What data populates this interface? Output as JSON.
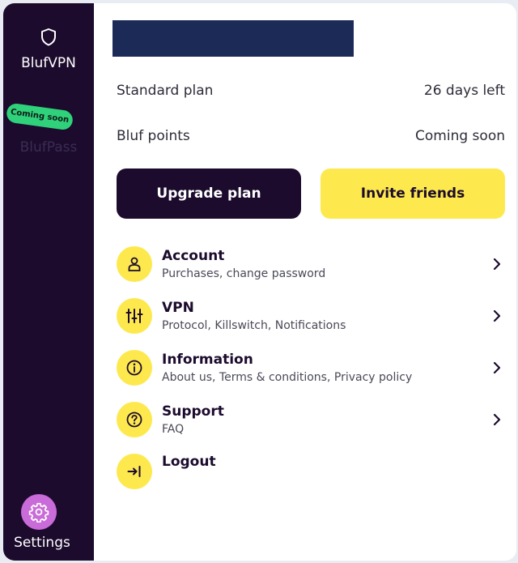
{
  "sidebar": {
    "items": [
      {
        "label": "BlufVPN",
        "icon": "shield-icon"
      },
      {
        "label": "BlufPass",
        "icon": "",
        "badge": "Coming soon"
      }
    ],
    "settings": {
      "label": "Settings",
      "icon": "gear-icon"
    }
  },
  "plan": {
    "name": "Standard plan",
    "remaining": "26 days left"
  },
  "points": {
    "label": "Bluf points",
    "value": "Coming soon"
  },
  "buttons": {
    "upgrade": "Upgrade plan",
    "invite": "Invite friends"
  },
  "menu": [
    {
      "title": "Account",
      "subtitle": "Purchases, change password",
      "icon": "user-icon"
    },
    {
      "title": "VPN",
      "subtitle": "Protocol, Killswitch, Notifications",
      "icon": "sliders-icon"
    },
    {
      "title": "Information",
      "subtitle": "About us, Terms & conditions, Privacy policy",
      "icon": "info-icon"
    },
    {
      "title": "Support",
      "subtitle": "FAQ",
      "icon": "question-icon"
    },
    {
      "title": "Logout",
      "subtitle": "",
      "icon": "logout-icon"
    }
  ],
  "colors": {
    "sidebar": "#1c0b2d",
    "accent_yellow": "#fde94e",
    "badge_green": "#2fd27a",
    "settings_pink": "#c96bd8",
    "banner": "#1c2a58"
  }
}
